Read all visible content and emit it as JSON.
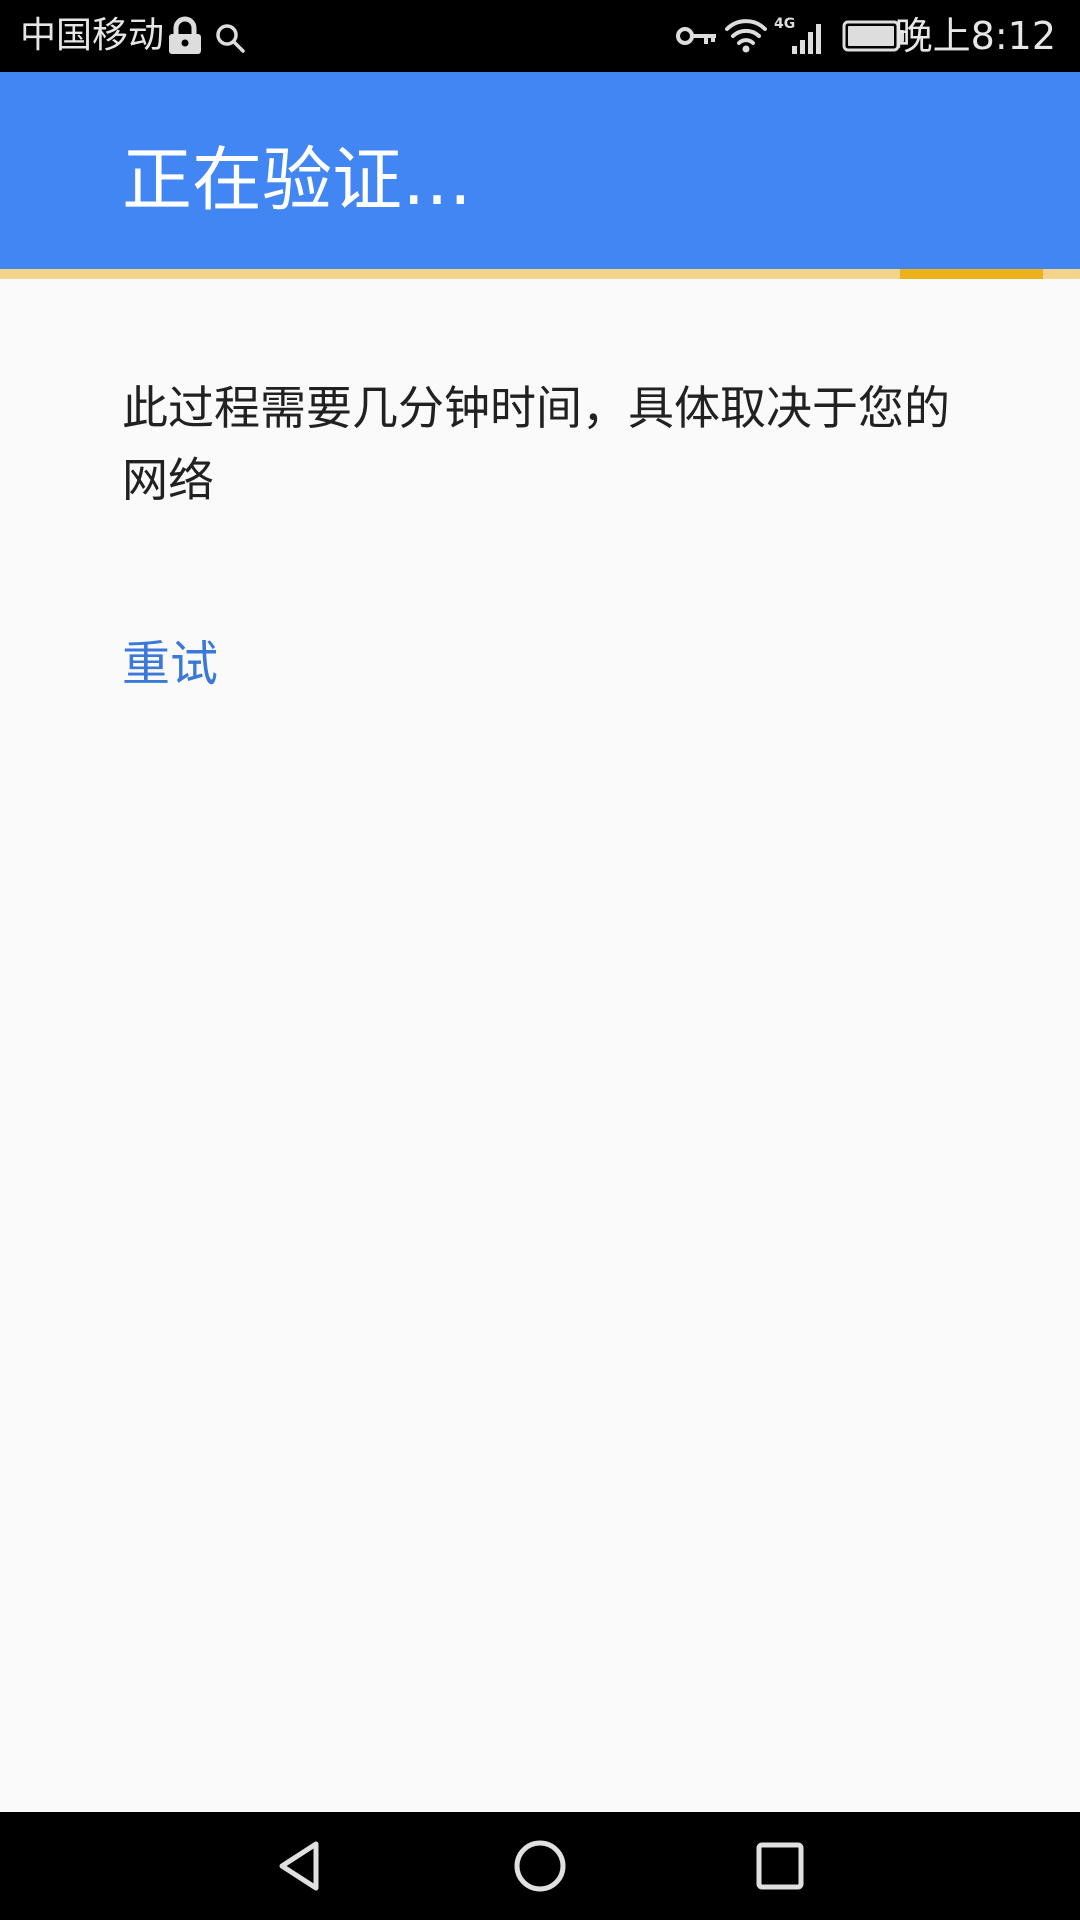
{
  "status_bar": {
    "carrier": "中国移动",
    "network_type": "4G",
    "time": "晚上8:12",
    "icons": [
      "lock-icon",
      "search-icon",
      "key-icon",
      "wifi-icon",
      "signal-icon",
      "battery-icon"
    ]
  },
  "app_bar": {
    "title": "正在验证…",
    "color": "#4286f4"
  },
  "progress": {
    "indeterminate": true,
    "track_color": "#f3d48a",
    "fill_color": "#ecb21b"
  },
  "content": {
    "message": "此过程需要几分钟时间，具体取决于您的网络",
    "retry_label": "重试",
    "link_color": "#3b78d8"
  },
  "nav_bar": {
    "icons": [
      "back-icon",
      "home-icon",
      "recents-icon"
    ]
  }
}
